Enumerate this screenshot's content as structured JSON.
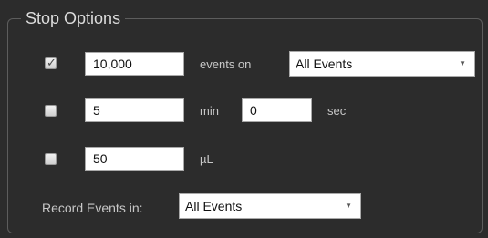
{
  "stop_options": {
    "title": "Stop Options",
    "events_row": {
      "checked": true,
      "check_glyph": "✓",
      "value": "10,000",
      "label": "events on",
      "select_value": "All Events"
    },
    "time_row": {
      "checked": false,
      "minutes": "5",
      "min_label": "min",
      "seconds": "0",
      "sec_label": "sec"
    },
    "volume_row": {
      "checked": false,
      "value": "50",
      "unit_label": "µL"
    },
    "record": {
      "label": "Record Events in:",
      "select_value": "All Events"
    },
    "icons": {
      "dropdown": "chevron-down-icon",
      "check": "checkmark-icon"
    }
  }
}
